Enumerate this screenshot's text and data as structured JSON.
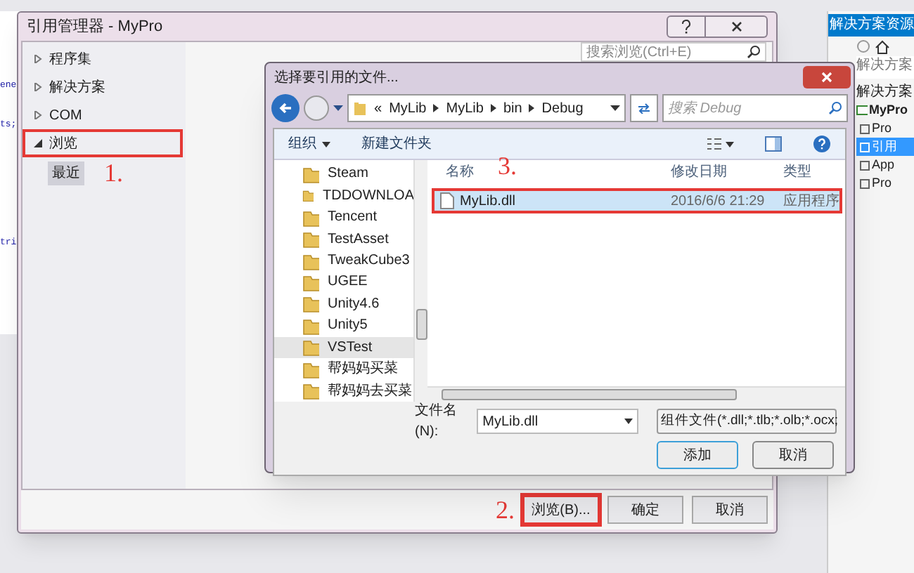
{
  "editor": {
    "code_fragments": [
      "ene",
      "ts;",
      "tri"
    ]
  },
  "solution_explorer": {
    "title": "解决方案资源",
    "search": {
      "placeholder": "解决方案"
    },
    "tree": [
      {
        "label": "解决方案",
        "selected": false,
        "children": [
          {
            "label": "MyPro",
            "selected": false,
            "children": [
              {
                "label": "Pro",
                "selected": false
              },
              {
                "label": "引用",
                "selected": true
              },
              {
                "label": "App",
                "selected": false
              },
              {
                "label": "Pro",
                "selected": false
              }
            ]
          }
        ]
      }
    ]
  },
  "reference_manager": {
    "title": "引用管理器 - MyPro",
    "search": {
      "placeholder": "搜索浏览(Ctrl+E)"
    },
    "nav": [
      {
        "label": "程序集",
        "expanded": false,
        "highlighted": false
      },
      {
        "label": "解决方案",
        "expanded": false,
        "highlighted": false
      },
      {
        "label": "COM",
        "expanded": false,
        "highlighted": false
      },
      {
        "label": "浏览",
        "expanded": true,
        "highlighted": true,
        "annotation": "1.",
        "children": [
          {
            "label": "最近",
            "selected": true
          }
        ]
      }
    ],
    "buttons": [
      {
        "label": "浏览(B)...",
        "highlighted": true,
        "annotation": "2."
      },
      {
        "label": "确定",
        "highlighted": false
      },
      {
        "label": "取消",
        "highlighted": false
      }
    ]
  },
  "file_dialog": {
    "title": "选择要引用的文件...",
    "path_overflow": "«",
    "path": [
      "MyLib",
      "MyLib",
      "bin",
      "Debug"
    ],
    "search": {
      "placeholder": "搜索 Debug"
    },
    "toolbar": [
      {
        "label": "组织",
        "dropdown": true
      },
      {
        "label": "新建文件夹",
        "dropdown": false
      }
    ],
    "folders": [
      {
        "label": "Steam",
        "selected": false
      },
      {
        "label": "TDDOWNLOA",
        "selected": false
      },
      {
        "label": "Tencent",
        "selected": false
      },
      {
        "label": "TestAsset",
        "selected": false
      },
      {
        "label": "TweakCube3",
        "selected": false
      },
      {
        "label": "UGEE",
        "selected": false
      },
      {
        "label": "Unity4.6",
        "selected": false
      },
      {
        "label": "Unity5",
        "selected": false
      },
      {
        "label": "VSTest",
        "selected": true
      },
      {
        "label": "帮妈妈买菜",
        "selected": false
      },
      {
        "label": "帮妈妈去买菜",
        "selected": false
      }
    ],
    "columns": [
      "名称",
      "修改日期",
      "类型"
    ],
    "annotation": "3.",
    "files": [
      {
        "name": "MyLib.dll",
        "date": "2016/6/6 21:29",
        "type": "应用程序",
        "selected": true,
        "highlighted": true
      }
    ],
    "file_name": {
      "label": "文件名(N):",
      "value": "MyLib.dll"
    },
    "filter": "组件文件(*.dll;*.tlb;*.olb;*.ocx;",
    "buttons": [
      {
        "label": "添加",
        "default": true
      },
      {
        "label": "取消",
        "default": false
      }
    ]
  }
}
